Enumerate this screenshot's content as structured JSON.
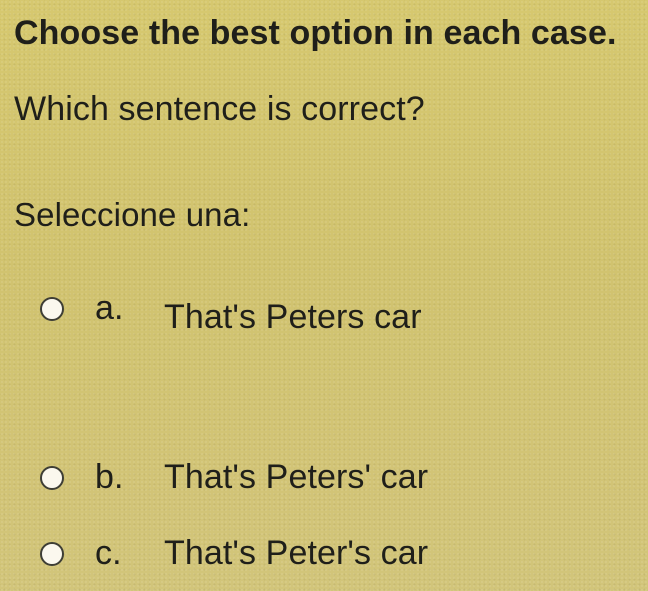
{
  "instruction": "Choose the best option in each case.",
  "question": "Which sentence is correct?",
  "select_label": "Seleccione una:",
  "options": [
    {
      "letter": "a.",
      "text": "That's Peters car",
      "selected": false
    },
    {
      "letter": "b.",
      "text": "That's Peters' car",
      "selected": false
    },
    {
      "letter": "c.",
      "text": "That's Peter's car",
      "selected": false
    }
  ]
}
